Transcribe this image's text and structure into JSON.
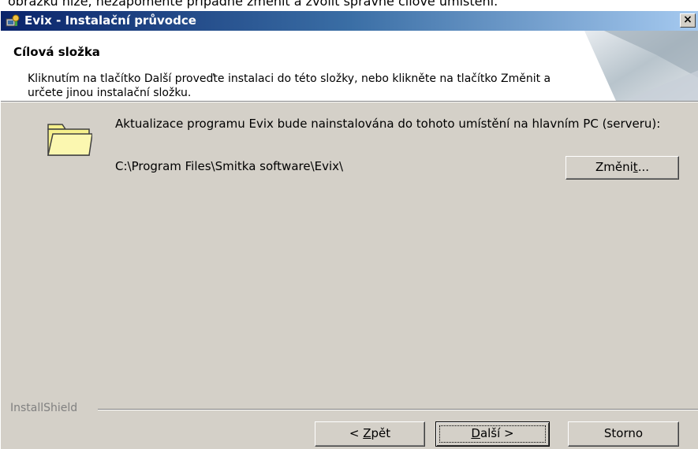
{
  "document": {
    "caption_fragment": "obrázku níže, nezapomeňte případně změnit a zvolit správné cílové umístění."
  },
  "window": {
    "title": "Evix - Instalační průvodce",
    "close_label": "×"
  },
  "header": {
    "title": "Cílová složka",
    "description": "Kliknutím na tlačítko Další proveďte instalaci do této složky, nebo klikněte na tlačítko Změnit a určete jinou instalační složku."
  },
  "content": {
    "message": "Aktualizace programu Evix bude nainstalována do tohoto umístění na hlavním PC (serveru):",
    "install_path": "C:\\Program Files\\Smitka software\\Evix\\",
    "change_button": {
      "before": "Změni",
      "accel": "t",
      "after": "..."
    }
  },
  "footer": {
    "brand": "InstallShield",
    "back_button": {
      "prefix": "< ",
      "accel": "Z",
      "rest": "pět"
    },
    "next_button": {
      "accel": "D",
      "rest": "alší >"
    },
    "cancel_label": "Storno"
  },
  "colors": {
    "titlebar_start": "#0a246a",
    "titlebar_end": "#a6caf0",
    "dialog_bg": "#d4d0c8",
    "folder_yellow": "#f5f08c"
  }
}
